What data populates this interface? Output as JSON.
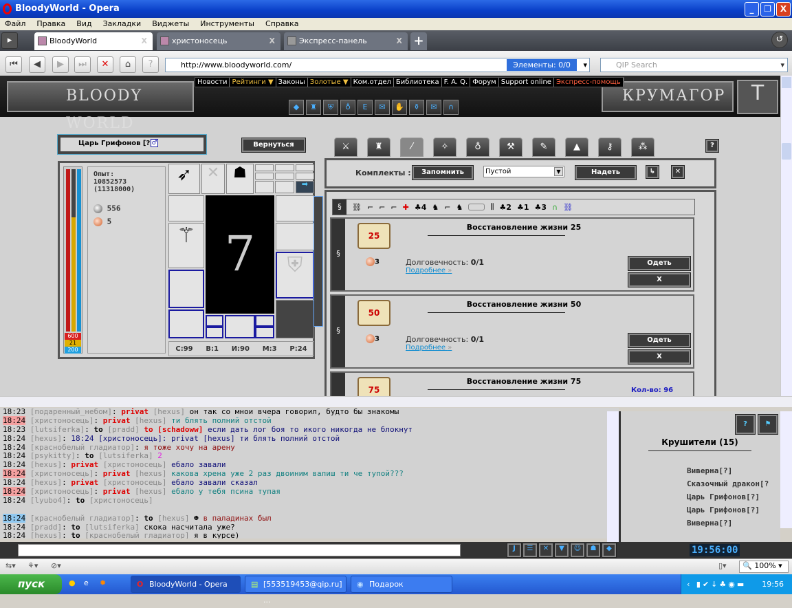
{
  "window": {
    "title": "BloodyWorld - Opera",
    "min": "_",
    "restore": "❐",
    "close": "X"
  },
  "menu": [
    "Файл",
    "Правка",
    "Вид",
    "Закладки",
    "Виджеты",
    "Инструменты",
    "Справка"
  ],
  "tabs": [
    {
      "label": "BloodyWorld",
      "active": true
    },
    {
      "label": "христоносець"
    },
    {
      "label": "Экспресс-панель"
    }
  ],
  "tab_close": "X",
  "tab_add": "+",
  "address": {
    "url": "http://www.bloodyworld.com/",
    "elements": "Элементы:   0/0",
    "search_placeholder": "QIP Search"
  },
  "game": {
    "logo": "BLOODY WORLD",
    "city": "КРУМАГОР",
    "nav": [
      {
        "label": "Новости"
      },
      {
        "label": "Рейтинги ▼",
        "c": "gold"
      },
      {
        "label": "Законы"
      },
      {
        "label": "Золотые ▼",
        "c": "gold"
      },
      {
        "label": "Ком.отдел"
      },
      {
        "label": "Библиотека"
      },
      {
        "label": "F. A. Q."
      },
      {
        "label": "Форум"
      },
      {
        "label": "Support online"
      },
      {
        "label": "Экспресс-помощь",
        "c": "red"
      }
    ],
    "character": {
      "name": "Царь Грифонов [?]",
      "back": "Вернуться",
      "exp_label": "Опыт:",
      "exp": "10852573",
      "exp_next": "(11318000)",
      "silver": "556",
      "copper": "5",
      "hp": "600",
      "mana": "21",
      "energy": "200",
      "stats": [
        "С:99",
        "В:1",
        "И:90",
        "М:3",
        "Р:24"
      ]
    },
    "kits": {
      "label": "Комплекты :",
      "remember": "Запомнить",
      "selected": "Пустой",
      "wear": "Надеть",
      "help": "?"
    },
    "filter_tag": "§",
    "filter_counts": [
      "4",
      "2",
      "1",
      "3"
    ],
    "items": [
      {
        "name": "Восстановление жизни 25",
        "badge": "25",
        "cost": "3",
        "dur_label": "Долговечность:",
        "dur": "0/1",
        "more": "Подробнее",
        "wear": "Одеть",
        "del": "X"
      },
      {
        "name": "Восстановление жизни 50",
        "badge": "50",
        "cost": "3",
        "dur_label": "Долговечность:",
        "dur": "0/1",
        "more": "Подробнее",
        "wear": "Одеть",
        "del": "X"
      },
      {
        "name": "Восстановление жизни 75",
        "badge": "75",
        "qty": "Кол-во: 96"
      }
    ]
  },
  "chat": [
    [
      [
        "18:23",
        "tm"
      ],
      [
        " [подаренный_небом]",
        "nm"
      ],
      [
        ": ",
        "c-blk"
      ],
      [
        "privat",
        "pv"
      ],
      [
        " [hexus]",
        "nm"
      ],
      [
        " он так со мнои вчера говорил, будто бы знакомы",
        "c-blk"
      ]
    ],
    [
      [
        "18:24",
        "tm hl"
      ],
      [
        " [христоносець]",
        "nm"
      ],
      [
        ": ",
        "c-blk"
      ],
      [
        "privat",
        "pv"
      ],
      [
        " [hexus]",
        "nm"
      ],
      [
        " ти блять полний отстой",
        "c-teal"
      ]
    ],
    [
      [
        "18:23",
        "tm"
      ],
      [
        " [lutsiferka]",
        "nm"
      ],
      [
        ": ",
        "c-blk"
      ],
      [
        "to",
        "to"
      ],
      [
        " [pradd] ",
        "nm"
      ],
      [
        "to [schadoww]",
        "pv"
      ],
      [
        " если дать лог боя то икого никогда не блокнут",
        "c-navy"
      ]
    ],
    [
      [
        "18:24",
        "tm"
      ],
      [
        " [hexus]",
        "nm"
      ],
      [
        ": ",
        "c-blk"
      ],
      [
        "18:24 [христоносець]: privat [hexus] ти блять полний отстой",
        "c-navy"
      ]
    ],
    [
      [
        "18:24",
        "tm"
      ],
      [
        " [краснобелый гладиатор]",
        "nm"
      ],
      [
        ": ",
        "c-blk"
      ],
      [
        "я тоже хочу на арену",
        "c-red"
      ]
    ],
    [
      [
        "18:24",
        "tm"
      ],
      [
        " [psykitty]",
        "nm"
      ],
      [
        ": ",
        "c-blk"
      ],
      [
        "to",
        "to"
      ],
      [
        " [lutsiferka]",
        "nm"
      ],
      [
        " 2",
        "c-mag"
      ]
    ],
    [
      [
        "18:24",
        "tm"
      ],
      [
        " [hexus]",
        "nm"
      ],
      [
        ": ",
        "c-blk"
      ],
      [
        "privat",
        "pv"
      ],
      [
        " [христоносець]",
        "nm"
      ],
      [
        " ебало завали",
        "c-navy"
      ]
    ],
    [
      [
        "18:24",
        "tm hl"
      ],
      [
        " [христоносець]",
        "nm"
      ],
      [
        ": ",
        "c-blk"
      ],
      [
        "privat",
        "pv"
      ],
      [
        " [hexus]",
        "nm"
      ],
      [
        " какова хрена уже 2 раз двоиним валиш ти че тупой???",
        "c-teal"
      ]
    ],
    [
      [
        "18:24",
        "tm"
      ],
      [
        " [hexus]",
        "nm"
      ],
      [
        ": ",
        "c-blk"
      ],
      [
        "privat",
        "pv"
      ],
      [
        " [христоносець]",
        "nm"
      ],
      [
        " ебало завали сказал",
        "c-navy"
      ]
    ],
    [
      [
        "18:24",
        "tm hl"
      ],
      [
        " [христоносець]",
        "nm"
      ],
      [
        ": ",
        "c-blk"
      ],
      [
        "privat",
        "pv"
      ],
      [
        " [hexus]",
        "nm"
      ],
      [
        " ебало у тебя псина тупая",
        "c-teal"
      ]
    ],
    [
      [
        "18:24",
        "tm"
      ],
      [
        " [lyubo4]",
        "nm"
      ],
      [
        ": ",
        "c-blk"
      ],
      [
        "to",
        "to"
      ],
      [
        " [христоносець]",
        "nm"
      ]
    ],
    [],
    [
      [
        "18:24",
        "tm hb"
      ],
      [
        " [краснобелый гладиатор]",
        "nm"
      ],
      [
        ": ",
        "c-blk"
      ],
      [
        "to",
        "to"
      ],
      [
        " [hexus]",
        "nm"
      ],
      [
        "  ☻ ",
        "c-blk"
      ],
      [
        "в паладинах был",
        "c-red"
      ]
    ],
    [
      [
        "18:24",
        "tm"
      ],
      [
        " [pradd]",
        "nm"
      ],
      [
        ": ",
        "c-blk"
      ],
      [
        "to",
        "to"
      ],
      [
        " [lutsiferka]",
        "nm"
      ],
      [
        " скока насчитала уже?",
        "c-blk"
      ]
    ],
    [
      [
        "18:24",
        "tm"
      ],
      [
        " [hexus]",
        "nm"
      ],
      [
        ": ",
        "c-blk"
      ],
      [
        "to",
        "to"
      ],
      [
        " [краснобелый гладиатор]",
        "nm"
      ],
      [
        " я в курсе)",
        "c-blk"
      ]
    ]
  ],
  "clan": {
    "title": "Крушители (15)",
    "members": [
      "Виверна[?]",
      "Сказочный дракон[?",
      "Царь Грифонов[?]",
      "Царь Грифонов[?]",
      "Виверна[?]"
    ]
  },
  "clock": "19:56:00",
  "status": {
    "zoom": "100%"
  },
  "taskbar": {
    "start": "пуск",
    "tasks": [
      "BloodyWorld - Opera",
      "[553519453@qip.ru] ...",
      "Подарок"
    ],
    "time": "19:56"
  }
}
